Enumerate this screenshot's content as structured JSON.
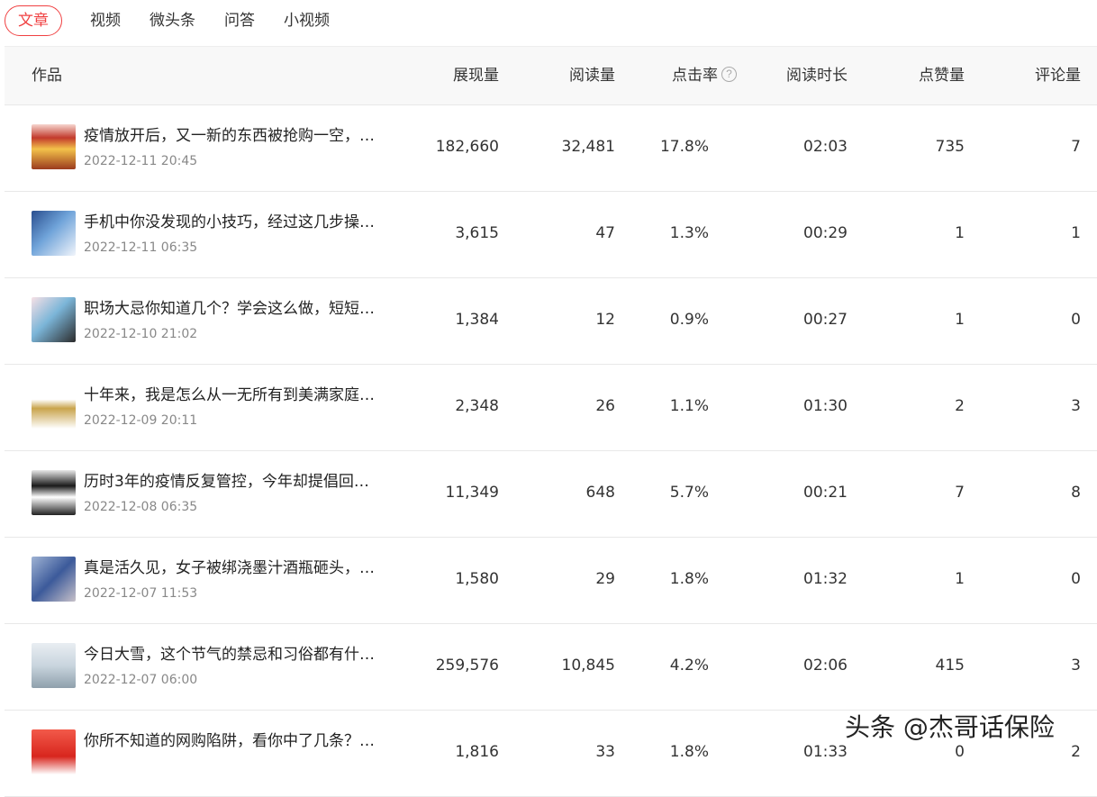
{
  "tabs": [
    {
      "label": "文章",
      "active": true
    },
    {
      "label": "视频",
      "active": false
    },
    {
      "label": "微头条",
      "active": false
    },
    {
      "label": "问答",
      "active": false
    },
    {
      "label": "小视频",
      "active": false
    }
  ],
  "columns": [
    "作品",
    "展现量",
    "阅读量",
    "点击率",
    "阅读时长",
    "点赞量",
    "评论量"
  ],
  "help_icon_glyph": "?",
  "accent_color": "#f04142",
  "rows": [
    {
      "title": "疫情放开后，又一新的东西被抢购一空，…",
      "date": "2022-12-11 20:45",
      "impressions": "182,660",
      "reads": "32,481",
      "ctr": "17.8%",
      "duration": "02:03",
      "likes": "735",
      "comments": "7"
    },
    {
      "title": "手机中你没发现的小技巧，经过这几步操…",
      "date": "2022-12-11 06:35",
      "impressions": "3,615",
      "reads": "47",
      "ctr": "1.3%",
      "duration": "00:29",
      "likes": "1",
      "comments": "1"
    },
    {
      "title": "职场大忌你知道几个？学会这么做，短短…",
      "date": "2022-12-10 21:02",
      "impressions": "1,384",
      "reads": "12",
      "ctr": "0.9%",
      "duration": "00:27",
      "likes": "1",
      "comments": "0"
    },
    {
      "title": "十年来，我是怎么从一无所有到美满家庭…",
      "date": "2022-12-09 20:11",
      "impressions": "2,348",
      "reads": "26",
      "ctr": "1.1%",
      "duration": "01:30",
      "likes": "2",
      "comments": "3"
    },
    {
      "title": "历时3年的疫情反复管控，今年却提倡回…",
      "date": "2022-12-08 06:35",
      "impressions": "11,349",
      "reads": "648",
      "ctr": "5.7%",
      "duration": "00:21",
      "likes": "7",
      "comments": "8"
    },
    {
      "title": "真是活久见，女子被绑浇墨汁酒瓶砸头，…",
      "date": "2022-12-07 11:53",
      "impressions": "1,580",
      "reads": "29",
      "ctr": "1.8%",
      "duration": "01:32",
      "likes": "1",
      "comments": "0"
    },
    {
      "title": "今日大雪，这个节气的禁忌和习俗都有什…",
      "date": "2022-12-07 06:00",
      "impressions": "259,576",
      "reads": "10,845",
      "ctr": "4.2%",
      "duration": "02:06",
      "likes": "415",
      "comments": "3"
    },
    {
      "title": "你所不知道的网购陷阱，看你中了几条？…",
      "date": "",
      "impressions": "1,816",
      "reads": "33",
      "ctr": "1.8%",
      "duration": "01:33",
      "likes": "0",
      "comments": "2"
    }
  ],
  "watermark": "头条 @杰哥话保险"
}
